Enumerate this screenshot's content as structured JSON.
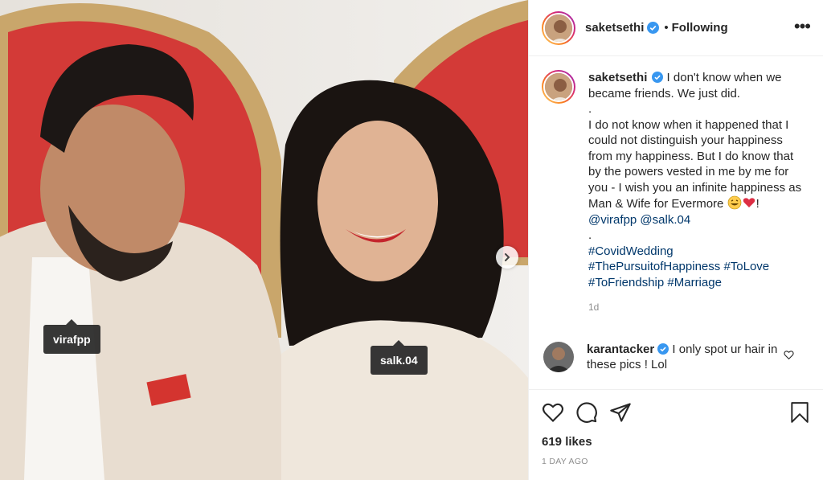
{
  "post": {
    "username": "saketsethi",
    "follow_status": "Following",
    "caption": {
      "line1": "I don't know when we became friends. We just did.",
      "sep1": ".",
      "body": "I do not know when it happened that I could not distinguish your happiness from my happiness. But I do know that by the powers vested in me by me for you - I wish you an infinite happiness as Man & Wife for Evermore",
      "mention1": "@virafpp",
      "mention2": "@salk.04",
      "sep2": ".",
      "hashtags": [
        "#CovidWedding",
        "#ThePursuitofHappiness",
        "#ToLove",
        "#ToFriendship",
        "#Marriage"
      ],
      "time": "1d"
    },
    "comment": {
      "username": "karantacker",
      "text": "I only spot ur hair in these pics ! Lol"
    },
    "likes": "619 likes",
    "posted": "1 DAY AGO"
  },
  "photo_tags": [
    "virafpp",
    "salk.04"
  ],
  "icons": [
    "verified-badge-icon",
    "more-options-icon",
    "next-arrow-icon",
    "heart-icon",
    "comment-icon",
    "share-icon",
    "bookmark-icon",
    "small-heart-icon"
  ],
  "colors": {
    "verified": "#3897f0",
    "link": "#00376b",
    "muted": "#8e8e8e",
    "border": "#efefef"
  }
}
